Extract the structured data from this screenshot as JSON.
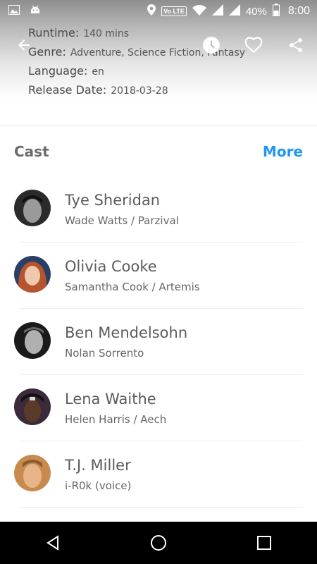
{
  "status": {
    "battery": "40%",
    "time": "8:00",
    "network_badge": "Vo LTE",
    "icons": [
      "image-icon",
      "android-icon",
      "location-icon",
      "wifi-icon",
      "signal-icon",
      "battery-icon"
    ]
  },
  "details": [
    {
      "label": "Runtime:",
      "value": "140 mins"
    },
    {
      "label": "Genre:",
      "value": "Adventure, Science Fiction, Fantasy"
    },
    {
      "label": "Language:",
      "value": "en"
    },
    {
      "label": "Release Date:",
      "value": "2018-03-28"
    }
  ],
  "actions": [
    "back-icon",
    "watch-later-icon",
    "favorite-icon",
    "share-icon"
  ],
  "cast": {
    "title": "Cast",
    "more_label": "More",
    "members": [
      {
        "name": "Tye Sheridan",
        "role": "Wade Watts / Parzival"
      },
      {
        "name": "Olivia Cooke",
        "role": "Samantha Cook / Artemis"
      },
      {
        "name": "Ben Mendelsohn",
        "role": "Nolan Sorrento"
      },
      {
        "name": "Lena Waithe",
        "role": "Helen Harris / Aech"
      },
      {
        "name": "T.J. Miller",
        "role": "i-R0k (voice)"
      }
    ]
  },
  "colors": {
    "accent": "#2196f3",
    "text_dark": "#5b5b5b",
    "navbar": "#000000"
  }
}
